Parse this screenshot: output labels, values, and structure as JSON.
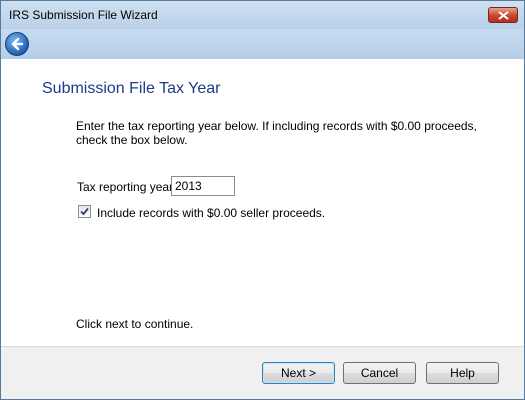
{
  "window": {
    "title": "IRS Submission File Wizard"
  },
  "page": {
    "heading": "Submission File Tax Year",
    "instructions": "Enter the tax reporting year below.  If including records with $0.00 proceeds, check the box below.",
    "year_label": "Tax reporting year:",
    "year_value": "2013",
    "checkbox_label": "Include records with $0.00 seller proceeds.",
    "checkbox_checked": true,
    "continue_text": "Click next to continue."
  },
  "buttons": {
    "next": "Next >",
    "cancel": "Cancel",
    "help": "Help"
  },
  "icons": {
    "close": "close-icon",
    "back": "back-arrow-icon",
    "check": "checkmark-icon"
  },
  "colors": {
    "heading": "#1f3a8c",
    "titlebar": "#b9d1ea"
  }
}
